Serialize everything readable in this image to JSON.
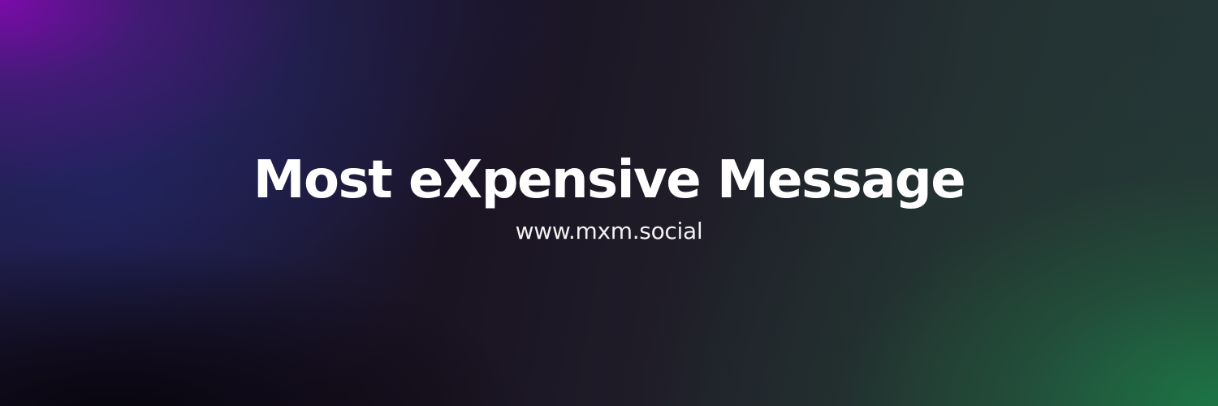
{
  "banner": {
    "title": "Most eXpensive Message",
    "website": "www.mxm.social"
  },
  "colors": {
    "text": "#ffffff",
    "gradient_top_left": "#800aaf",
    "gradient_center": "#1a1322",
    "gradient_bottom_right": "#1c7846"
  }
}
